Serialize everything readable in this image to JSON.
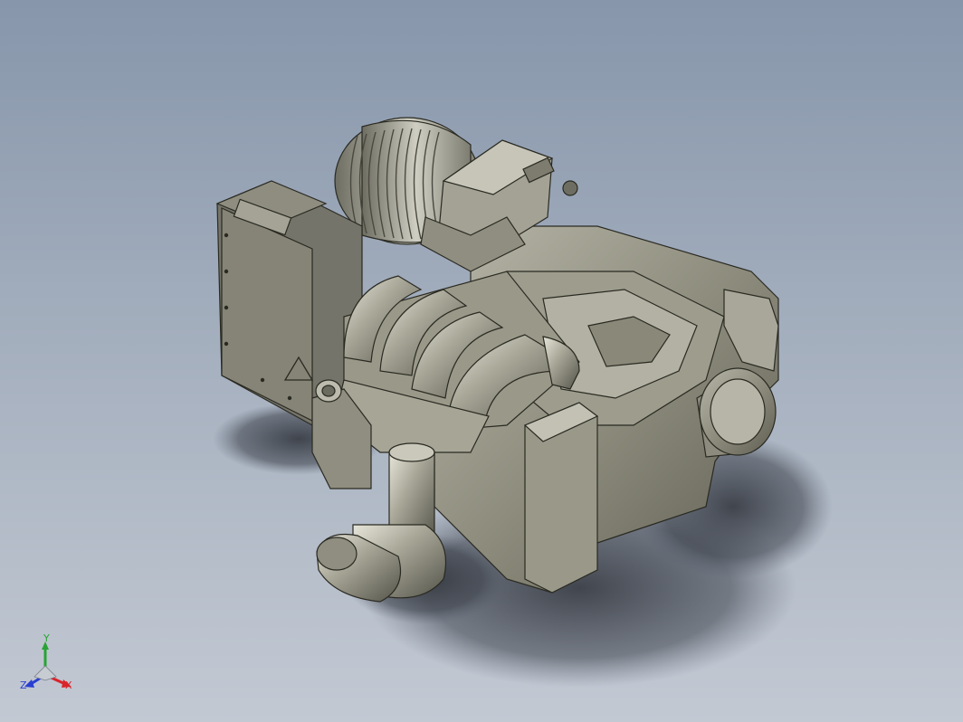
{
  "viewport": {
    "background_top": "#8796ab",
    "background_bottom": "#c3c9d3",
    "model_color": "#8b8a7a",
    "edge_color": "#2a2a22"
  },
  "model": {
    "subject": "engine-assembly-3d-model"
  },
  "triad": {
    "x_label": "X",
    "y_label": "Y",
    "z_label": "Z",
    "x_color": "#d8242a",
    "y_color": "#27a334",
    "z_color": "#2a3fd1"
  }
}
